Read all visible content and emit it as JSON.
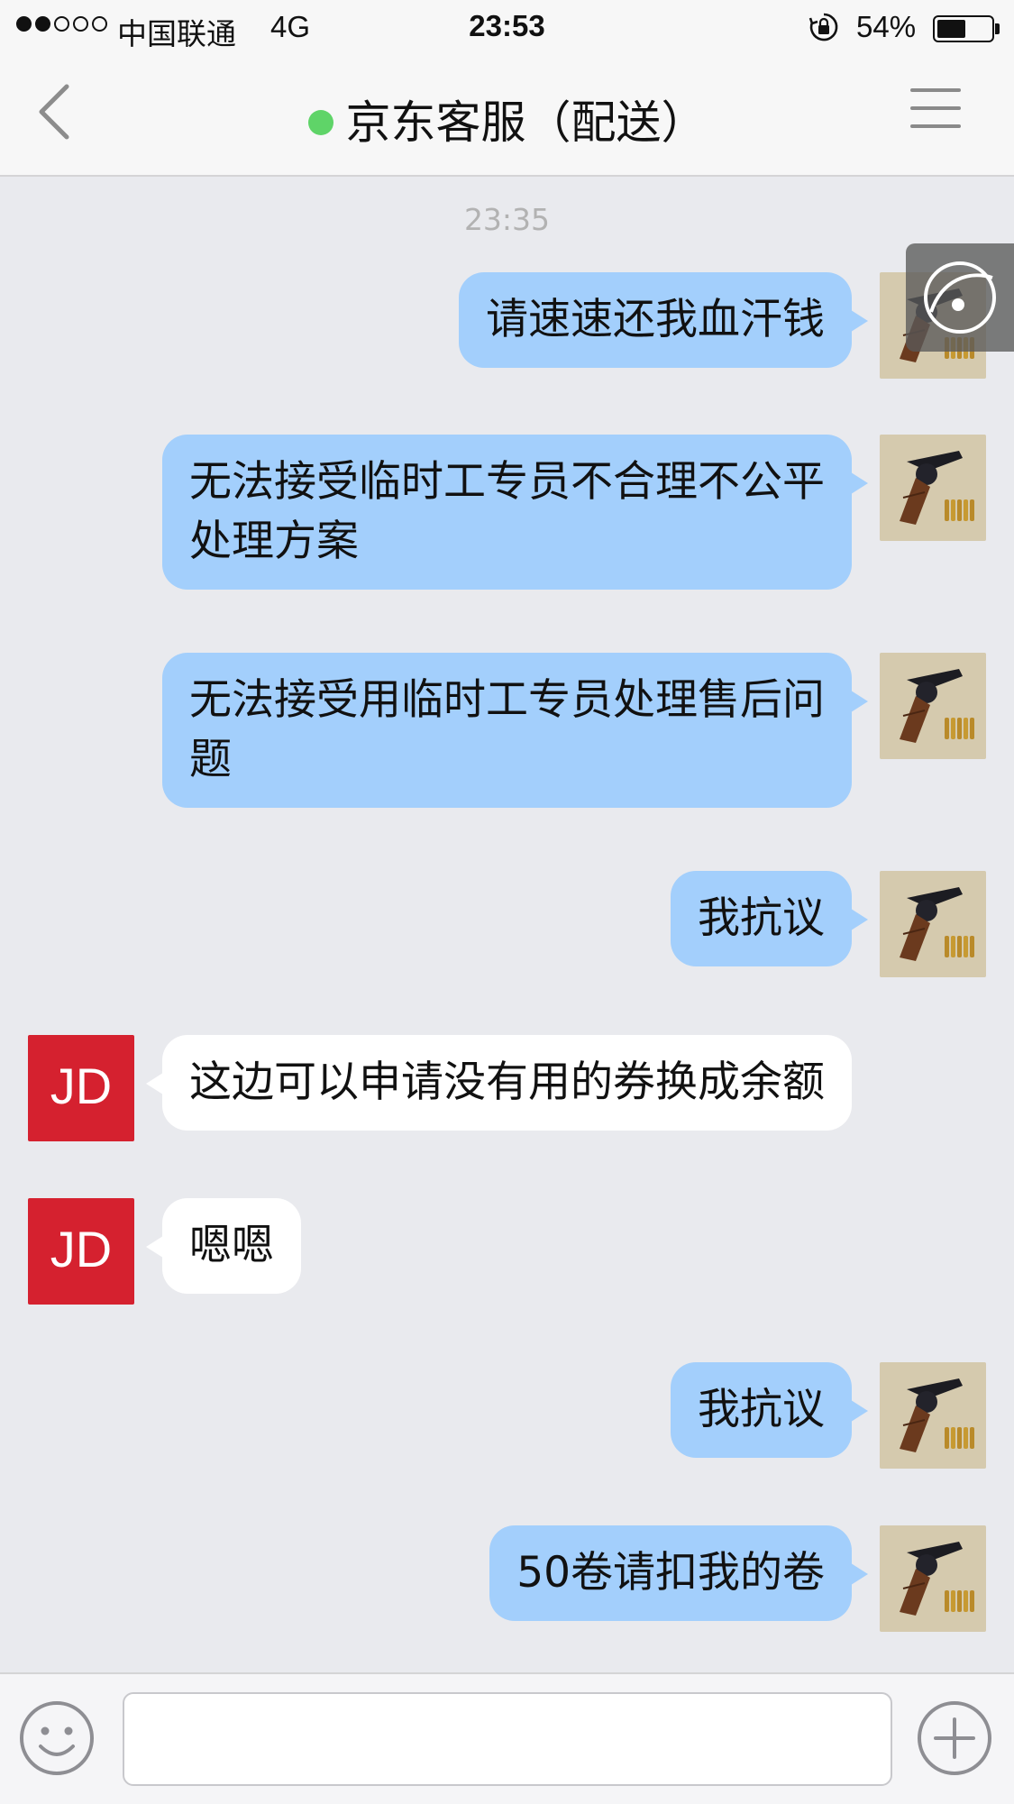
{
  "status_bar": {
    "carrier": "中国联通",
    "network": "4G",
    "time": "23:53",
    "battery": "54%",
    "battery_level": 0.54,
    "signal_bars_filled": 2,
    "signal_bars_total": 5,
    "icons": [
      "rotation-lock-icon",
      "battery-icon"
    ]
  },
  "nav": {
    "title": "京东客服（配送）",
    "online_status_color": "#5fd468",
    "back_icon": "chevron-left-icon",
    "menu_icon": "menu-icon"
  },
  "chat": {
    "timestamp": "23:35",
    "messages": [
      {
        "sender": "me",
        "lines": [
          "请速速还我血汗钱"
        ]
      },
      {
        "sender": "me",
        "lines": [
          "无法接受临时工专员不合理不公平",
          "处理方案"
        ]
      },
      {
        "sender": "me",
        "lines": [
          "无法接受用临时工专员处理售后问",
          "题"
        ]
      },
      {
        "sender": "me",
        "lines": [
          "我抗议"
        ]
      },
      {
        "sender": "agent",
        "avatar_text": "JD",
        "lines": [
          "这边可以申请没有用的券换成余额"
        ]
      },
      {
        "sender": "agent",
        "avatar_text": "JD",
        "lines": [
          "嗯嗯"
        ]
      },
      {
        "sender": "me",
        "lines": [
          "我抗议"
        ]
      },
      {
        "sender": "me",
        "lines": [
          "50卷请扣我的卷"
        ]
      }
    ]
  },
  "colors": {
    "my_bubble": "#a3cffc",
    "agent_bubble": "#ffffff",
    "jd_brand_red": "#d5212f",
    "chat_background": "#e9eaee"
  },
  "input_bar": {
    "placeholder": "",
    "emoji_icon": "smiley-icon",
    "plus_icon": "plus-icon"
  }
}
